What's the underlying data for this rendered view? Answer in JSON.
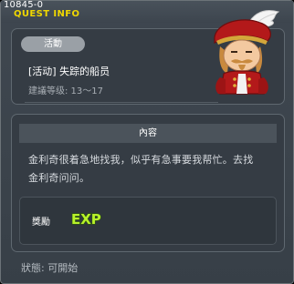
{
  "window": {
    "quest_id": "10845-0",
    "title": "QUEST INFO"
  },
  "quest": {
    "category": "活動",
    "name": "[活动] 失踪的船员",
    "level": "建議等级: 13～17",
    "npc_icon": "pirate-captain-portrait-icon"
  },
  "content": {
    "header": "內容",
    "description_line1": "金利奇很着急地找我，似乎有急事要我帮忙。去找",
    "description_line2": "金利奇问问。"
  },
  "reward": {
    "label": "獎勵",
    "exp_icon": "exp-icon"
  },
  "status": "狀態: 可開始"
}
